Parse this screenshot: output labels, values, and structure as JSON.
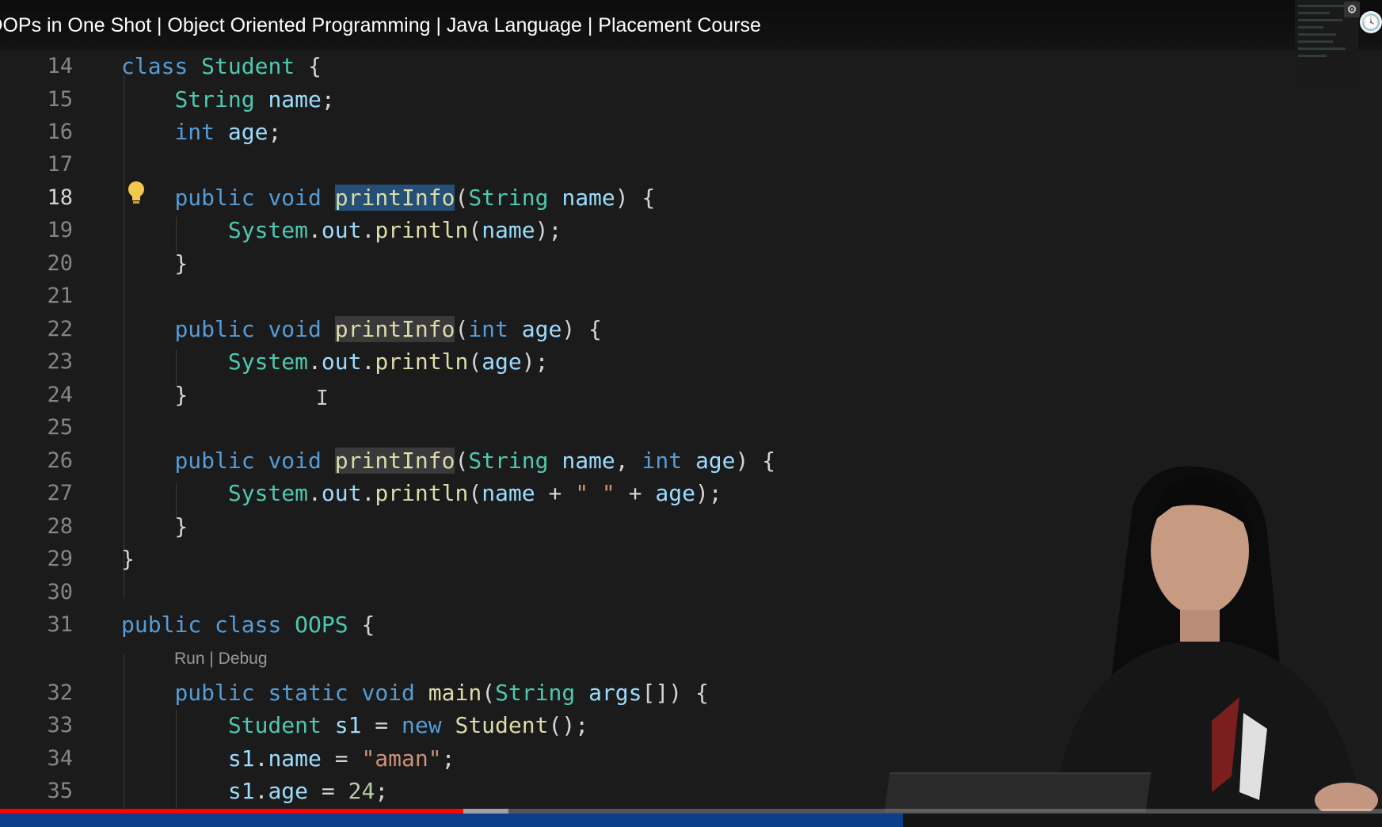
{
  "video": {
    "title": "OOPs in One Shot | Object Oriented Programming | Java Language | Placement Course",
    "progress_fraction": 0.335,
    "buffered_fraction": 0.368
  },
  "editor": {
    "codelens": "Run | Debug",
    "lines": [
      {
        "n": "14",
        "tokens": [
          [
            "class",
            "kw"
          ],
          [
            " ",
            ""
          ],
          [
            "Student",
            "ty"
          ],
          [
            " {",
            ""
          ]
        ]
      },
      {
        "n": "15",
        "tokens": [
          [
            "    ",
            ""
          ],
          [
            "String",
            "ty"
          ],
          [
            " ",
            ""
          ],
          [
            "name",
            "vr"
          ],
          [
            ";",
            ""
          ]
        ]
      },
      {
        "n": "16",
        "tokens": [
          [
            "    ",
            ""
          ],
          [
            "int",
            "kw"
          ],
          [
            " ",
            ""
          ],
          [
            "age",
            "vr"
          ],
          [
            ";",
            ""
          ]
        ]
      },
      {
        "n": "17",
        "tokens": []
      },
      {
        "n": "18",
        "active": true,
        "tokens": [
          [
            "    ",
            ""
          ],
          [
            "public",
            "kw"
          ],
          [
            " ",
            ""
          ],
          [
            "void",
            "kw"
          ],
          [
            " ",
            ""
          ],
          [
            "printInfo",
            "fn hl-sel"
          ],
          [
            "(",
            ""
          ],
          [
            "String",
            "ty"
          ],
          [
            " ",
            ""
          ],
          [
            "name",
            "vr"
          ],
          [
            ") {",
            ""
          ]
        ]
      },
      {
        "n": "19",
        "tokens": [
          [
            "        ",
            ""
          ],
          [
            "System",
            "ty"
          ],
          [
            ".",
            ""
          ],
          [
            "out",
            "vr"
          ],
          [
            ".",
            ""
          ],
          [
            "println",
            "fn"
          ],
          [
            "(",
            ""
          ],
          [
            "name",
            "vr"
          ],
          [
            ");",
            ""
          ]
        ]
      },
      {
        "n": "20",
        "tokens": [
          [
            "    }",
            ""
          ]
        ]
      },
      {
        "n": "21",
        "tokens": []
      },
      {
        "n": "22",
        "tokens": [
          [
            "    ",
            ""
          ],
          [
            "public",
            "kw"
          ],
          [
            " ",
            ""
          ],
          [
            "void",
            "kw"
          ],
          [
            " ",
            ""
          ],
          [
            "printInfo",
            "fn hl-word"
          ],
          [
            "(",
            ""
          ],
          [
            "int",
            "kw"
          ],
          [
            " ",
            ""
          ],
          [
            "age",
            "vr"
          ],
          [
            ") {",
            ""
          ]
        ]
      },
      {
        "n": "23",
        "tokens": [
          [
            "        ",
            ""
          ],
          [
            "System",
            "ty"
          ],
          [
            ".",
            ""
          ],
          [
            "out",
            "vr"
          ],
          [
            ".",
            ""
          ],
          [
            "println",
            "fn"
          ],
          [
            "(",
            ""
          ],
          [
            "age",
            "vr"
          ],
          [
            ");",
            ""
          ]
        ]
      },
      {
        "n": "24",
        "tokens": [
          [
            "    }",
            ""
          ]
        ]
      },
      {
        "n": "25",
        "tokens": []
      },
      {
        "n": "26",
        "tokens": [
          [
            "    ",
            ""
          ],
          [
            "public",
            "kw"
          ],
          [
            " ",
            ""
          ],
          [
            "void",
            "kw"
          ],
          [
            " ",
            ""
          ],
          [
            "printInfo",
            "fn hl-word"
          ],
          [
            "(",
            ""
          ],
          [
            "String",
            "ty"
          ],
          [
            " ",
            ""
          ],
          [
            "name",
            "vr"
          ],
          [
            ", ",
            ""
          ],
          [
            "int",
            "kw"
          ],
          [
            " ",
            ""
          ],
          [
            "age",
            "vr"
          ],
          [
            ") {",
            ""
          ]
        ]
      },
      {
        "n": "27",
        "tokens": [
          [
            "        ",
            ""
          ],
          [
            "System",
            "ty"
          ],
          [
            ".",
            ""
          ],
          [
            "out",
            "vr"
          ],
          [
            ".",
            ""
          ],
          [
            "println",
            "fn"
          ],
          [
            "(",
            ""
          ],
          [
            "name",
            "vr"
          ],
          [
            " + ",
            ""
          ],
          [
            "\" \"",
            "st"
          ],
          [
            " + ",
            ""
          ],
          [
            "age",
            "vr"
          ],
          [
            ");",
            ""
          ]
        ]
      },
      {
        "n": "28",
        "tokens": [
          [
            "    }",
            ""
          ]
        ]
      },
      {
        "n": "29",
        "tokens": [
          [
            "}",
            ""
          ]
        ]
      },
      {
        "n": "30",
        "tokens": []
      },
      {
        "n": "31",
        "tokens": [
          [
            "public",
            "kw"
          ],
          [
            " ",
            ""
          ],
          [
            "class",
            "kw"
          ],
          [
            " ",
            ""
          ],
          [
            "OOPS",
            "ty"
          ],
          [
            " {",
            ""
          ]
        ]
      },
      {
        "n": "32",
        "tokens": [
          [
            "    ",
            ""
          ],
          [
            "public",
            "kw"
          ],
          [
            " ",
            ""
          ],
          [
            "static",
            "kw"
          ],
          [
            " ",
            ""
          ],
          [
            "void",
            "kw"
          ],
          [
            " ",
            ""
          ],
          [
            "main",
            "fn"
          ],
          [
            "(",
            ""
          ],
          [
            "String",
            "ty"
          ],
          [
            " ",
            ""
          ],
          [
            "args",
            "vr"
          ],
          [
            "[]) {",
            ""
          ]
        ]
      },
      {
        "n": "33",
        "tokens": [
          [
            "        ",
            ""
          ],
          [
            "Student",
            "ty"
          ],
          [
            " ",
            ""
          ],
          [
            "s1",
            "vr"
          ],
          [
            " = ",
            ""
          ],
          [
            "new",
            "kw"
          ],
          [
            " ",
            ""
          ],
          [
            "Student",
            "fn"
          ],
          [
            "();",
            ""
          ]
        ]
      },
      {
        "n": "34",
        "tokens": [
          [
            "        ",
            ""
          ],
          [
            "s1",
            "vr"
          ],
          [
            ".",
            ""
          ],
          [
            "name",
            "vr"
          ],
          [
            " = ",
            ""
          ],
          [
            "\"aman\"",
            "st"
          ],
          [
            ";",
            ""
          ]
        ]
      },
      {
        "n": "35",
        "tokens": [
          [
            "        ",
            ""
          ],
          [
            "s1",
            "vr"
          ],
          [
            ".",
            ""
          ],
          [
            "age",
            "vr"
          ],
          [
            " = ",
            ""
          ],
          [
            "24",
            "nm"
          ],
          [
            ";",
            ""
          ]
        ]
      }
    ]
  },
  "icons": {
    "bulb": "lightbulb-icon",
    "gear": "gear-icon",
    "clock": "watch-later-icon",
    "text_cursor": "text-cursor-icon"
  },
  "colors": {
    "keyword": "#569cd6",
    "type": "#4ec9b0",
    "function": "#dcdcaa",
    "variable": "#9cdcfe",
    "string": "#ce9178",
    "number": "#b5cea8",
    "progress": "#ff0000"
  }
}
